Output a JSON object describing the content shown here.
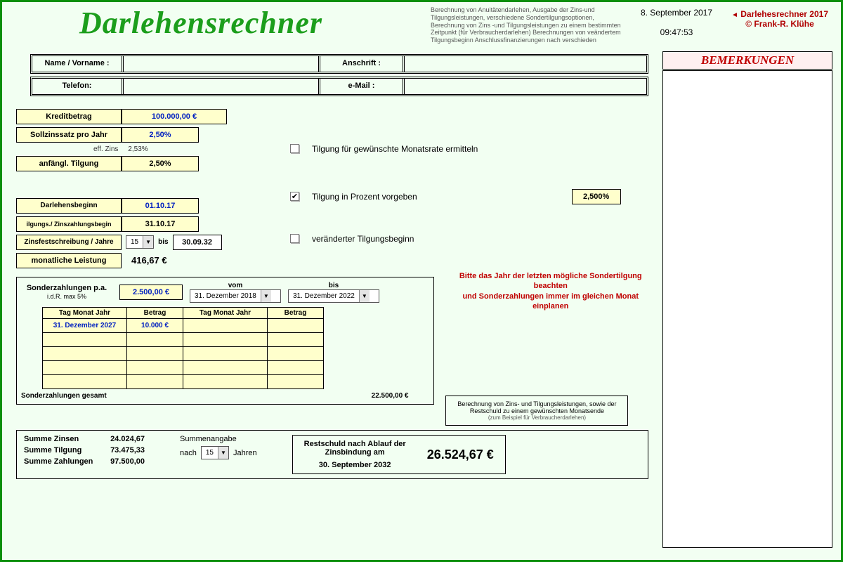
{
  "header": {
    "title": "Darlehensrechner",
    "description": "Berechnung von Anuitätendarlehen, Ausgabe der Zins-und Tilgungsleistungen, verschiedene Sondertilgungsoptionen, Berechnung von Zins -und Tilgungsleistungen zu einem bestimmten Zeitpunkt (für Verbraucherdarlehen) Berechnungen von veändertem Tilgungsbeginn Anschlussfinanzierungen nach verschieden",
    "date": "8. September 2017",
    "time": "09:47:53",
    "brand1": "Darlehesrechner  2017",
    "brand2": "© Frank-R. Klühe"
  },
  "info": {
    "name_label": "Name / Vorname :",
    "address_label": "Anschrift :",
    "phone_label": "Telefon:",
    "email_label": "e-Mail :"
  },
  "remarks_title": "BEMERKUNGEN",
  "fields": {
    "kredit_lbl": "Kreditbetrag",
    "kredit_val": "100.000,00 €",
    "soll_lbl": "Sollzinssatz pro Jahr",
    "soll_val": "2,50%",
    "eff_lbl": "eff. Zins",
    "eff_val": "2,53%",
    "anf_lbl": "anfängl. Tilgung",
    "anf_val": "2,50%",
    "darl_beg_lbl": "Darlehensbeginn",
    "darl_beg_val": "01.10.17",
    "tilg_beg_lbl": "ilgungs./ Zinszahlungsbegin",
    "tilg_beg_val": "31.10.17",
    "fest_lbl": "Zinsfestschreibung / Jahre",
    "fest_years": "15",
    "fest_bis": "bis",
    "fest_end": "30.09.32",
    "monat_lbl": "monatliche Leistung",
    "monat_val": "416,67 €"
  },
  "checks": {
    "c1": "Tilgung für gewünschte Monatsrate ermitteln",
    "c2": "Tilgung in Prozent vorgeben",
    "c2_val": "2,500%",
    "c3": "veränderter Tilgungsbeginn"
  },
  "sonder": {
    "label": "Sonderzahlungen p.a.",
    "sublabel": "i.d.R. max 5%",
    "amount": "2.500,00 €",
    "vom": "vom",
    "vom_val": "31. Dezember 2018",
    "bis": "bis",
    "bis_val": "31. Dezember 2022",
    "th1": "Tag Monat Jahr",
    "th2": "Betrag",
    "th3": "Tag Monat Jahr",
    "th4": "Betrag",
    "row1_date": "31. Dezember 2027",
    "row1_amt": "10.000 €",
    "total_lbl": "Sonderzahlungen gesamt",
    "total_val": "22.500,00 €",
    "warn1": "Bitte das Jahr der letzten mögliche Sondertilgung beachten",
    "warn2": "und Sonderzahlungen  immer im gleichen Monat einplanen",
    "note1": "Berechnung von Zins- und Tilgungsleistungen, sowie  der Restschuld zu einem gewünschten Monatsende",
    "note2": "(zum Beispiel  für Verbraucherdarlehen)"
  },
  "summary": {
    "s1_lbl": "Summe Zinsen",
    "s1_val": "24.024,67",
    "s2_lbl": "Summe Tilgung",
    "s2_val": "73.475,33",
    "s3_lbl": "Summe Zahlungen",
    "s3_val": "97.500,00",
    "angabe": "Summenangabe",
    "nach": "nach",
    "jahre_dd": "15",
    "jahren": "Jahren",
    "rest_lbl1": "Restschuld nach Ablauf der",
    "rest_lbl2": "Zinsbindung am",
    "rest_date": "30. September 2032",
    "rest_val": "26.524,67 €"
  }
}
